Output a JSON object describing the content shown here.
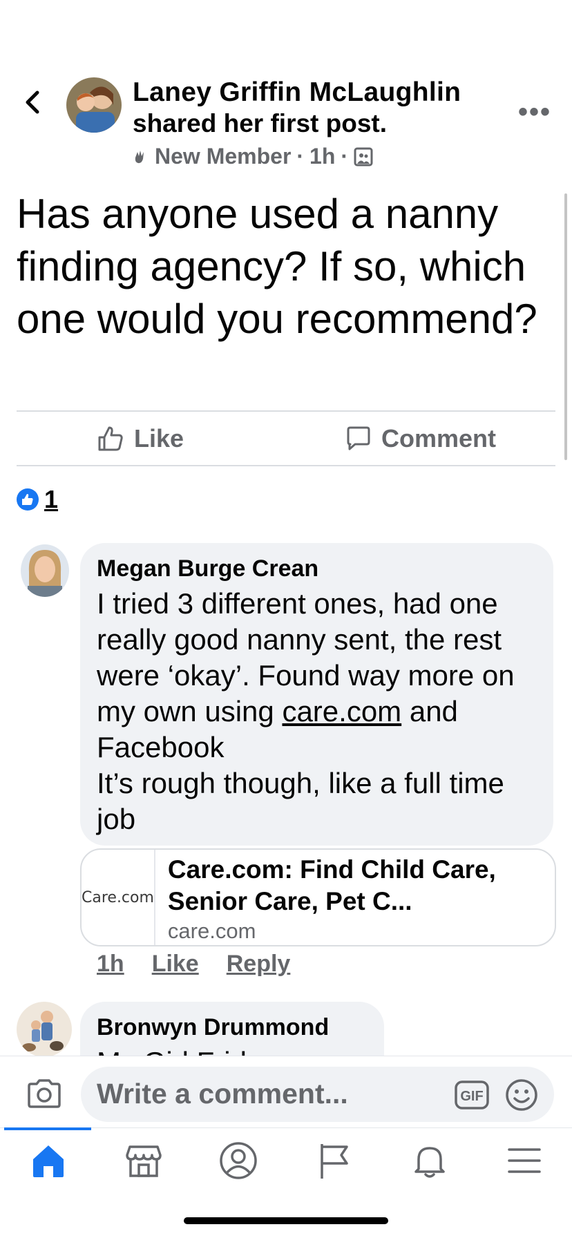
{
  "post": {
    "author": "Laney Griffin McLaughlin",
    "action_text": "shared her first post.",
    "badge": "New Member",
    "time": "1h",
    "text": "Has anyone used a nanny finding agency?  If so, which one would you recommend?"
  },
  "actions": {
    "like": "Like",
    "comment": "Comment"
  },
  "reactions": {
    "count": "1"
  },
  "comments": [
    {
      "author": "Megan Burge Crean",
      "text_part1": "I tried 3 different ones, had one really good nanny sent, the rest were ‘okay’. Found way more on my own using",
      "link_text": "care.com",
      "text_part2": "and Facebook",
      "text_part3": "It’s rough though, like a full time job",
      "time": "1h",
      "like": "Like",
      "reply": "Reply",
      "link_preview": {
        "logo": "Care.com",
        "title": "Care.com: Find Child Care, Senior Care, Pet C...",
        "domain": "care.com"
      }
    },
    {
      "author": "Bronwyn Drummond",
      "text_partial": "My Girl Friday"
    }
  ],
  "composer": {
    "placeholder": "Write a comment..."
  },
  "colors": {
    "accent": "#1877f2",
    "secondary_text": "#65676b",
    "bubble": "#f0f2f5"
  },
  "icons": [
    "back-icon",
    "more-icon",
    "globe-members-icon",
    "like-icon",
    "comment-icon",
    "camera-icon",
    "gif-icon",
    "emoji-icon",
    "home-icon",
    "marketplace-icon",
    "profile-icon",
    "pages-icon",
    "notifications-icon",
    "menu-icon"
  ]
}
